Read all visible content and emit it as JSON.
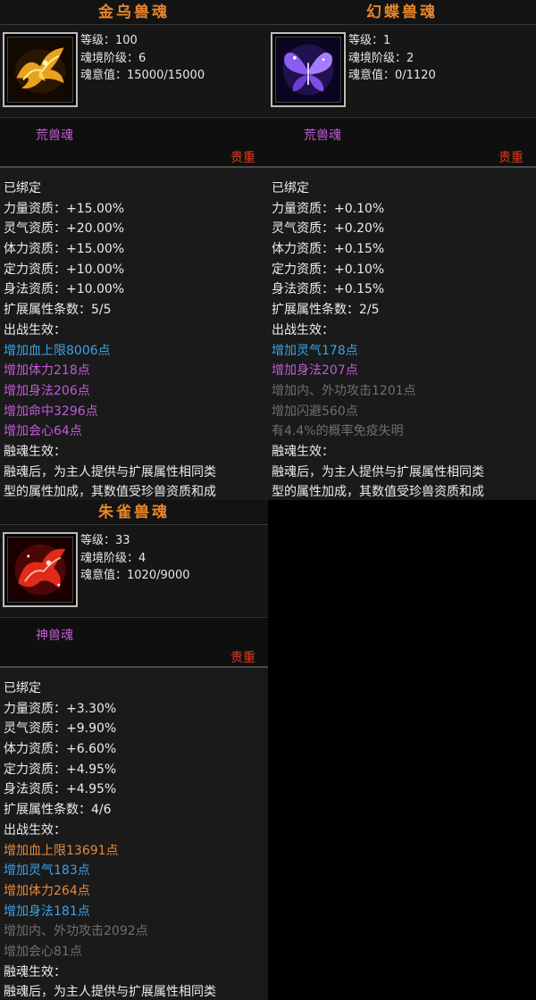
{
  "colors": {
    "title": "#e8862a",
    "blue": "#3aa4e8",
    "purple": "#c45ad8",
    "orange": "#e98a3a",
    "gray": "#6f6f6f",
    "rarity": "#e83a1c"
  },
  "cards": [
    {
      "title": "金乌兽魂",
      "icon": "golden-phoenix-icon",
      "level": "等级：100",
      "realm": "魂境阶级：6",
      "soul": "魂意值：15000/15000",
      "type": "荒兽魂",
      "rarity": "贵重",
      "lines": [
        {
          "text": "已绑定",
          "color": "white"
        },
        {
          "text": "力量资质：+15.00%",
          "color": "white"
        },
        {
          "text": "灵气资质：+20.00%",
          "color": "white"
        },
        {
          "text": "体力资质：+15.00%",
          "color": "white"
        },
        {
          "text": "定力资质：+10.00%",
          "color": "white"
        },
        {
          "text": "身法资质：+10.00%",
          "color": "white"
        },
        {
          "text": "扩展属性条数：5/5",
          "color": "white"
        },
        {
          "text": "出战生效：",
          "color": "white"
        },
        {
          "text": "增加血上限8006点",
          "color": "blue"
        },
        {
          "text": "增加体力218点",
          "color": "purple"
        },
        {
          "text": "增加身法206点",
          "color": "purple"
        },
        {
          "text": "增加命中3296点",
          "color": "purple"
        },
        {
          "text": "增加会心64点",
          "color": "purple"
        },
        {
          "text": "融魂生效：",
          "color": "white"
        },
        {
          "text": "融魂后，为主人提供与扩展属性相同类",
          "color": "white"
        },
        {
          "text": "型的属性加成，其数值受珍兽资质和成",
          "color": "white"
        }
      ]
    },
    {
      "title": "幻蝶兽魂",
      "icon": "butterfly-icon",
      "level": "等级：1",
      "realm": "魂境阶级：2",
      "soul": "魂意值：0/1120",
      "type": "荒兽魂",
      "rarity": "贵重",
      "lines": [
        {
          "text": "已绑定",
          "color": "white"
        },
        {
          "text": "力量资质：+0.10%",
          "color": "white"
        },
        {
          "text": "灵气资质：+0.20%",
          "color": "white"
        },
        {
          "text": "体力资质：+0.15%",
          "color": "white"
        },
        {
          "text": "定力资质：+0.10%",
          "color": "white"
        },
        {
          "text": "身法资质：+0.15%",
          "color": "white"
        },
        {
          "text": "扩展属性条数：2/5",
          "color": "white"
        },
        {
          "text": "出战生效：",
          "color": "white"
        },
        {
          "text": "增加灵气178点",
          "color": "blue"
        },
        {
          "text": "增加身法207点",
          "color": "purple"
        },
        {
          "text": "增加内、外功攻击1201点",
          "color": "gray"
        },
        {
          "text": "增加闪避560点",
          "color": "gray"
        },
        {
          "text": "有4.4%的概率免疫失明",
          "color": "gray"
        },
        {
          "text": "融魂生效：",
          "color": "white"
        },
        {
          "text": "融魂后，为主人提供与扩展属性相同类",
          "color": "white"
        },
        {
          "text": "型的属性加成，其数值受珍兽资质和成",
          "color": "white"
        }
      ]
    },
    {
      "title": "朱雀兽魂",
      "icon": "vermilion-bird-icon",
      "level": "等级：33",
      "realm": "魂境阶级：4",
      "soul": "魂意值：1020/9000",
      "type": "神兽魂",
      "rarity": "贵重",
      "lines": [
        {
          "text": "已绑定",
          "color": "white"
        },
        {
          "text": "力量资质：+3.30%",
          "color": "white"
        },
        {
          "text": "灵气资质：+9.90%",
          "color": "white"
        },
        {
          "text": "体力资质：+6.60%",
          "color": "white"
        },
        {
          "text": "定力资质：+4.95%",
          "color": "white"
        },
        {
          "text": "身法资质：+4.95%",
          "color": "white"
        },
        {
          "text": "扩展属性条数：4/6",
          "color": "white"
        },
        {
          "text": "出战生效：",
          "color": "white"
        },
        {
          "text": "增加血上限13691点",
          "color": "orange"
        },
        {
          "text": "增加灵气183点",
          "color": "blue"
        },
        {
          "text": "增加体力264点",
          "color": "orange"
        },
        {
          "text": "增加身法181点",
          "color": "blue"
        },
        {
          "text": "增加内、外功攻击2092点",
          "color": "gray"
        },
        {
          "text": "增加会心81点",
          "color": "gray"
        },
        {
          "text": "融魂生效：",
          "color": "white"
        },
        {
          "text": "融魂后，为主人提供与扩展属性相同类",
          "color": "white"
        }
      ]
    }
  ]
}
